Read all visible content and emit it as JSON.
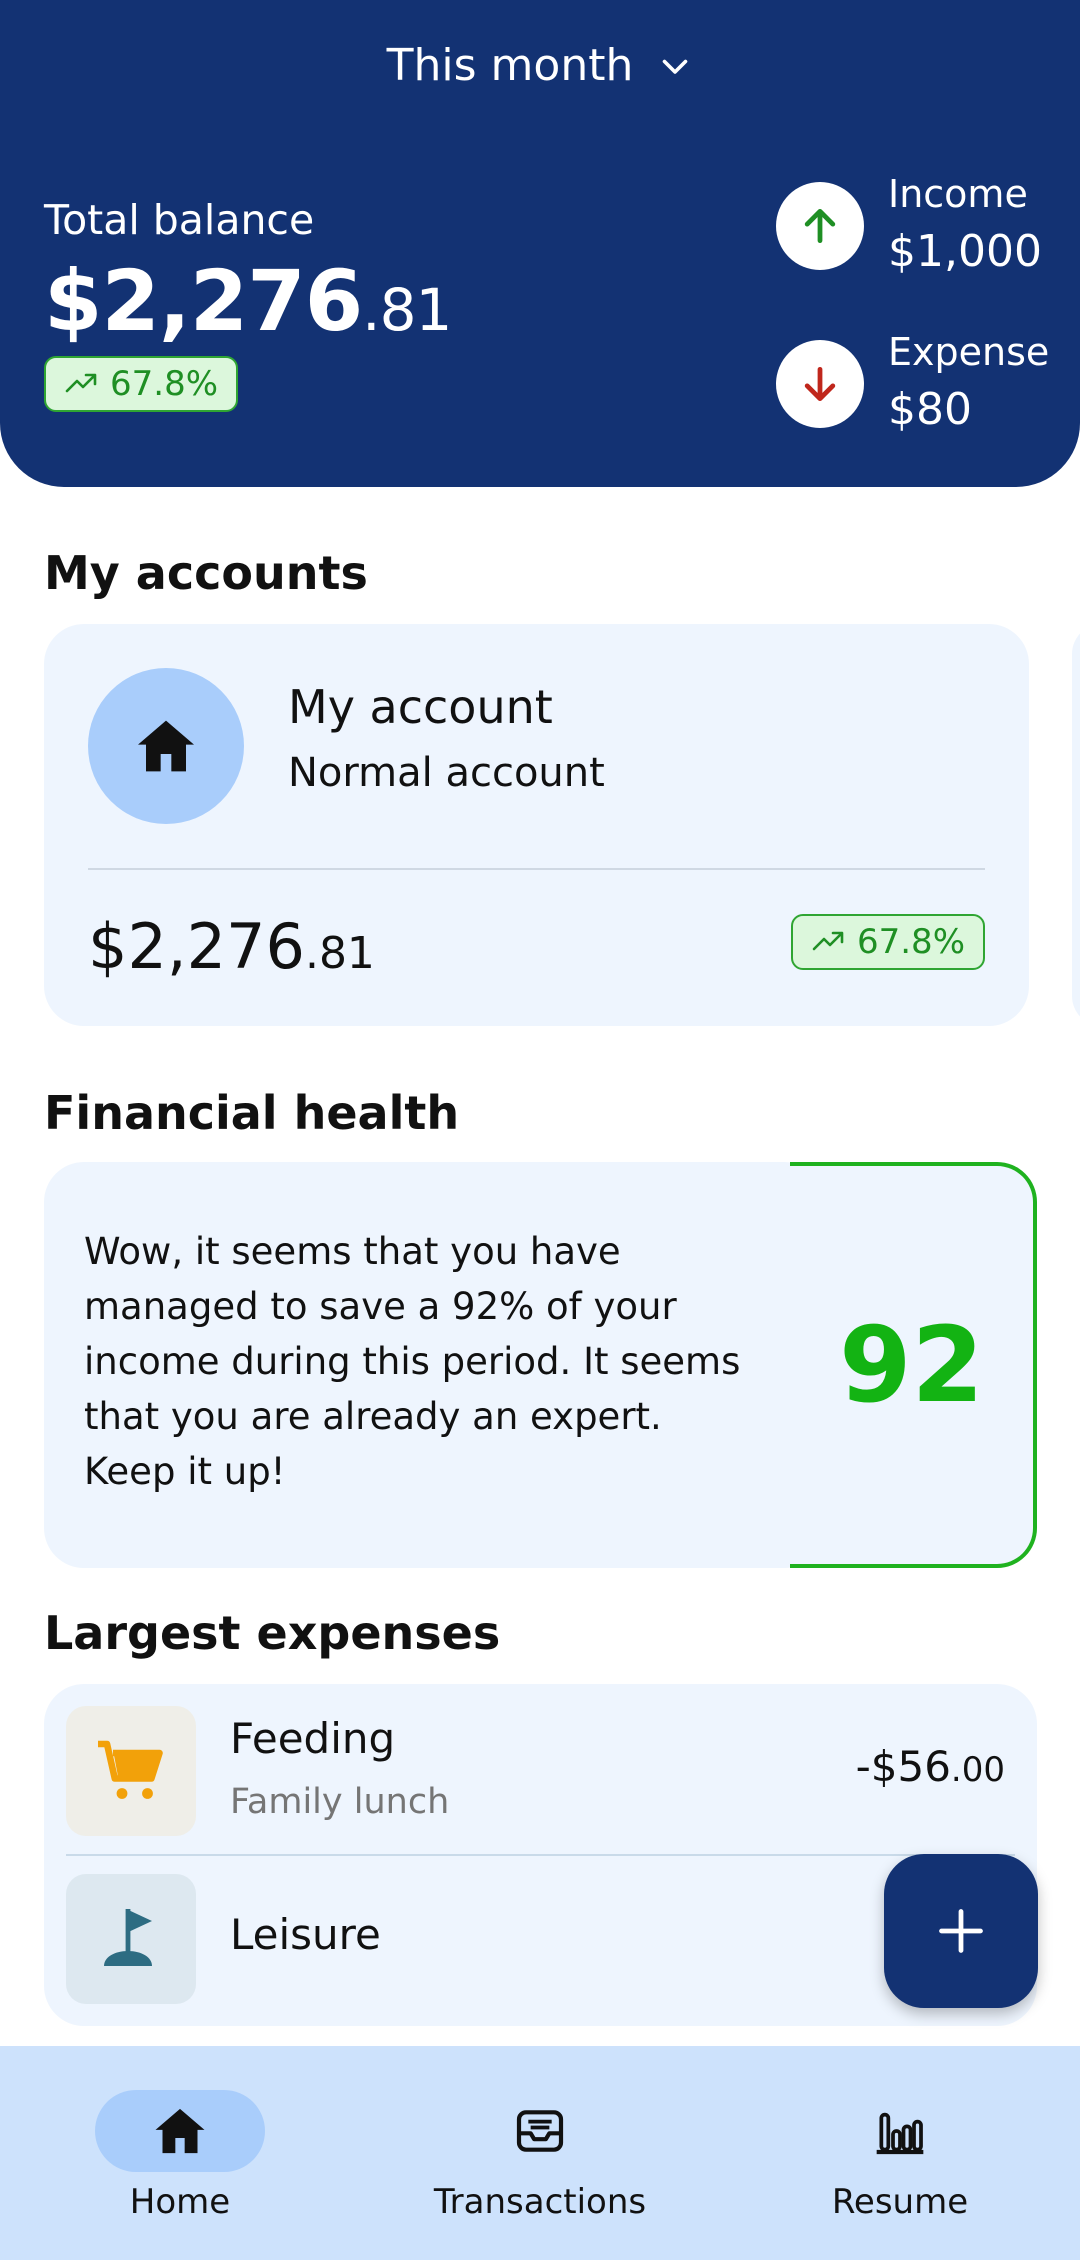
{
  "header": {
    "period_label": "This month",
    "total_balance_label": "Total balance",
    "balance_whole": "$2,276",
    "balance_cents": ".81",
    "balance_change": "67.8%",
    "income_label": "Income",
    "income_value": "$1,000",
    "expense_label": "Expense",
    "expense_value": "$80"
  },
  "accounts": {
    "title": "My accounts",
    "items": [
      {
        "name": "My account",
        "type": "Normal account",
        "amount_whole": "$2,276",
        "amount_cents": ".81",
        "change": "67.8%",
        "icon": "home-icon"
      }
    ]
  },
  "health": {
    "title": "Financial health",
    "message": "Wow, it seems that you have managed to save a 92% of your income during this period. It seems that you are already an expert. Keep it up!",
    "score": "92"
  },
  "expenses": {
    "title": "Largest expenses",
    "items": [
      {
        "category": "Feeding",
        "note": "Family lunch",
        "amount_whole": "-$56",
        "amount_cents": ".00",
        "icon": "cart-icon"
      },
      {
        "category": "Leisure",
        "note": "",
        "amount_whole": "-$",
        "amount_cents": "",
        "icon": "flag-icon"
      }
    ]
  },
  "nav": {
    "items": [
      {
        "label": "Home",
        "icon": "home-icon",
        "active": true
      },
      {
        "label": "Transactions",
        "icon": "inbox-icon",
        "active": false
      },
      {
        "label": "Resume",
        "icon": "bar-chart-icon",
        "active": false
      }
    ]
  },
  "colors": {
    "primary": "#133273",
    "positive": "#1f8f24",
    "negative": "#c0271c",
    "health_accent": "#13b313",
    "card_bg": "#eef5fe",
    "nav_bg": "#cde2fc"
  }
}
